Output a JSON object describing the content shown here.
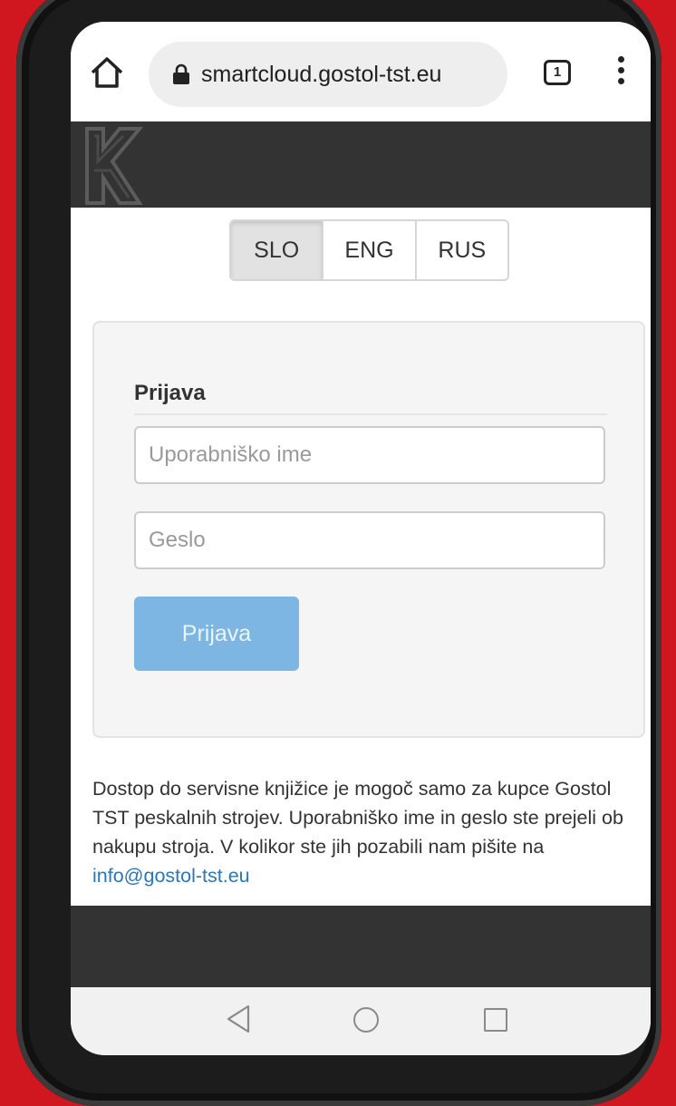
{
  "browser": {
    "url": "smartcloud.gostol-tst.eu",
    "tab_count": "1"
  },
  "languages": {
    "items": [
      "SLO",
      "ENG",
      "RUS"
    ],
    "active": "SLO"
  },
  "login": {
    "legend": "Prijava",
    "username_placeholder": "Uporabniško ime",
    "password_placeholder": "Geslo",
    "submit_label": "Prijava"
  },
  "info": {
    "text": "Dostop do servisne knjižice je mogoč samo za kupce Gostol TST peskalnih strojev. Uporabniško ime in geslo ste prejeli ob nakupu stroja. V kolikor ste jih pozabili nam pišite na ",
    "email": "info@gostol-tst.eu"
  },
  "icons": {
    "home": "home-icon",
    "lock": "lock-icon",
    "tabs": "tabs-icon",
    "menu": "more-vert-icon",
    "back": "back-triangle-icon",
    "home_nav": "home-circle-icon",
    "recents": "recents-square-icon"
  },
  "colors": {
    "background": "#d0161f",
    "header": "#333333",
    "primary_button": "#7db5e3",
    "link": "#2a78b8"
  }
}
